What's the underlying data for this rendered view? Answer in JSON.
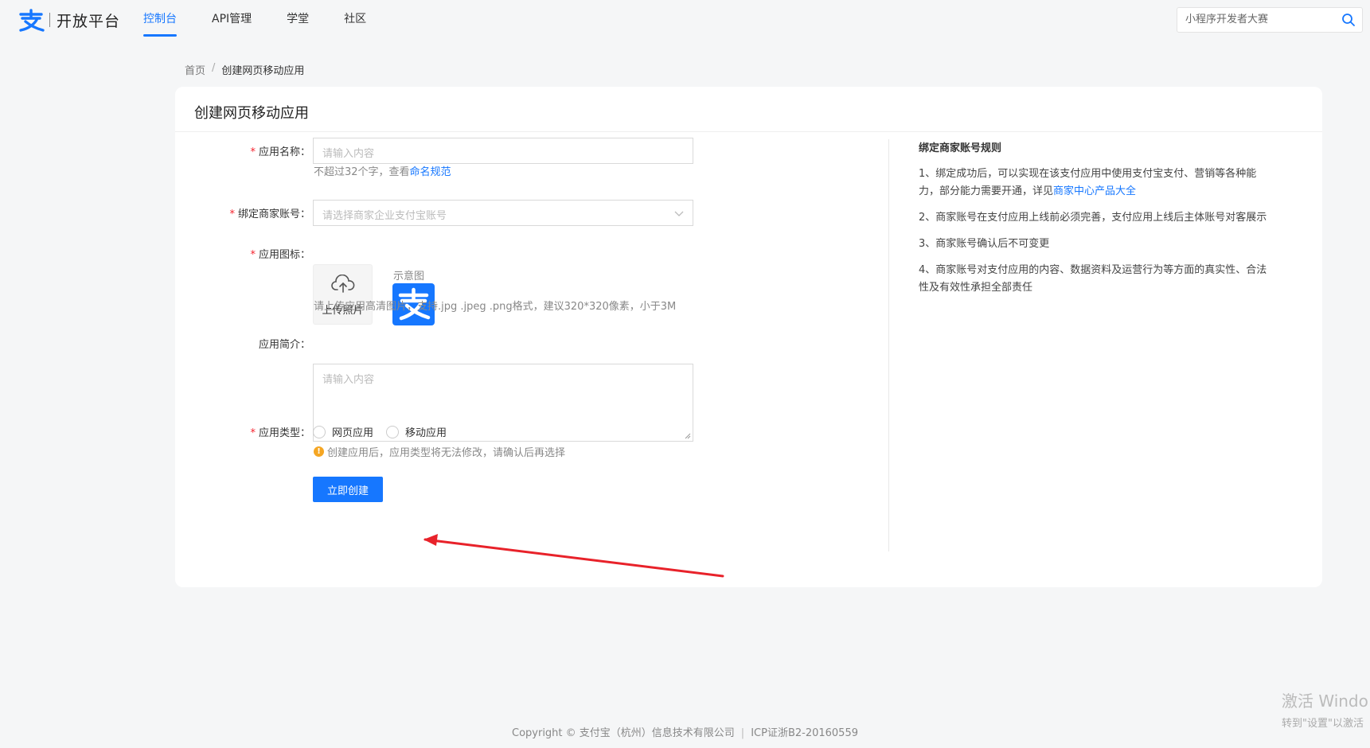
{
  "header": {
    "logo_text": "开放平台",
    "nav": [
      {
        "label": "控制台",
        "active": true
      },
      {
        "label": "API管理",
        "active": false
      },
      {
        "label": "学堂",
        "active": false
      },
      {
        "label": "社区",
        "active": false
      }
    ],
    "search_placeholder": "小程序开发者大赛"
  },
  "breadcrumb": {
    "home": "首页",
    "separator": "/",
    "current": "创建网页移动应用"
  },
  "card": {
    "title": "创建网页移动应用",
    "form": {
      "app_name": {
        "required": "*",
        "label": "应用名称：",
        "placeholder": "请输入内容",
        "help_prefix": "不超过32个字，查看",
        "help_link": "命名规范"
      },
      "merchant": {
        "required": "*",
        "label": "绑定商家账号：",
        "placeholder": "请选择商家企业支付宝账号"
      },
      "icon": {
        "required": "*",
        "label": "应用图标：",
        "upload_label": "上传照片",
        "sample_label": "示意图",
        "help": "请上传应用高清图片，支持.jpg .jpeg .png格式，建议320*320像素，小于3M"
      },
      "intro": {
        "label": "应用简介：",
        "placeholder": "请输入内容"
      },
      "type": {
        "required": "*",
        "label": "应用类型：",
        "options": [
          "网页应用",
          "移动应用"
        ],
        "warning_icon": "!",
        "warning": "创建应用后，应用类型将无法修改，请确认后再选择"
      },
      "submit_label": "立即创建"
    },
    "rules": {
      "title": "绑定商家账号规则",
      "items": [
        {
          "text": "1、绑定成功后，可以实现在该支付应用中使用支付宝支付、营销等各种能力，部分能力需要开通，详见",
          "link": "商家中心产品大全"
        },
        {
          "text": "2、商家账号在支付应用上线前必须完善，支付应用上线后主体账号对客展示",
          "link": ""
        },
        {
          "text": "3、商家账号确认后不可变更",
          "link": ""
        },
        {
          "text": "4、商家账号对支付应用的内容、数据资料及运营行为等方面的真实性、合法性及有效性承担全部责任",
          "link": ""
        }
      ]
    }
  },
  "footer": {
    "copyright": "Copyright © 支付宝（杭州）信息技术有限公司",
    "separator": "|",
    "icp": "ICP证浙B2-20160559"
  },
  "watermark": {
    "line1": "激活 Windo",
    "line2": "转到\"设置\"以激活"
  },
  "colors": {
    "brand": "#1677ff",
    "required": "#f5222d",
    "warning": "#f5a623",
    "annotation_arrow": "#e8222a"
  },
  "icons": [
    "alipay-logo-icon",
    "search-icon",
    "chevron-down-icon",
    "upload-cloud-icon",
    "warning-icon",
    "annotation-arrow"
  ]
}
